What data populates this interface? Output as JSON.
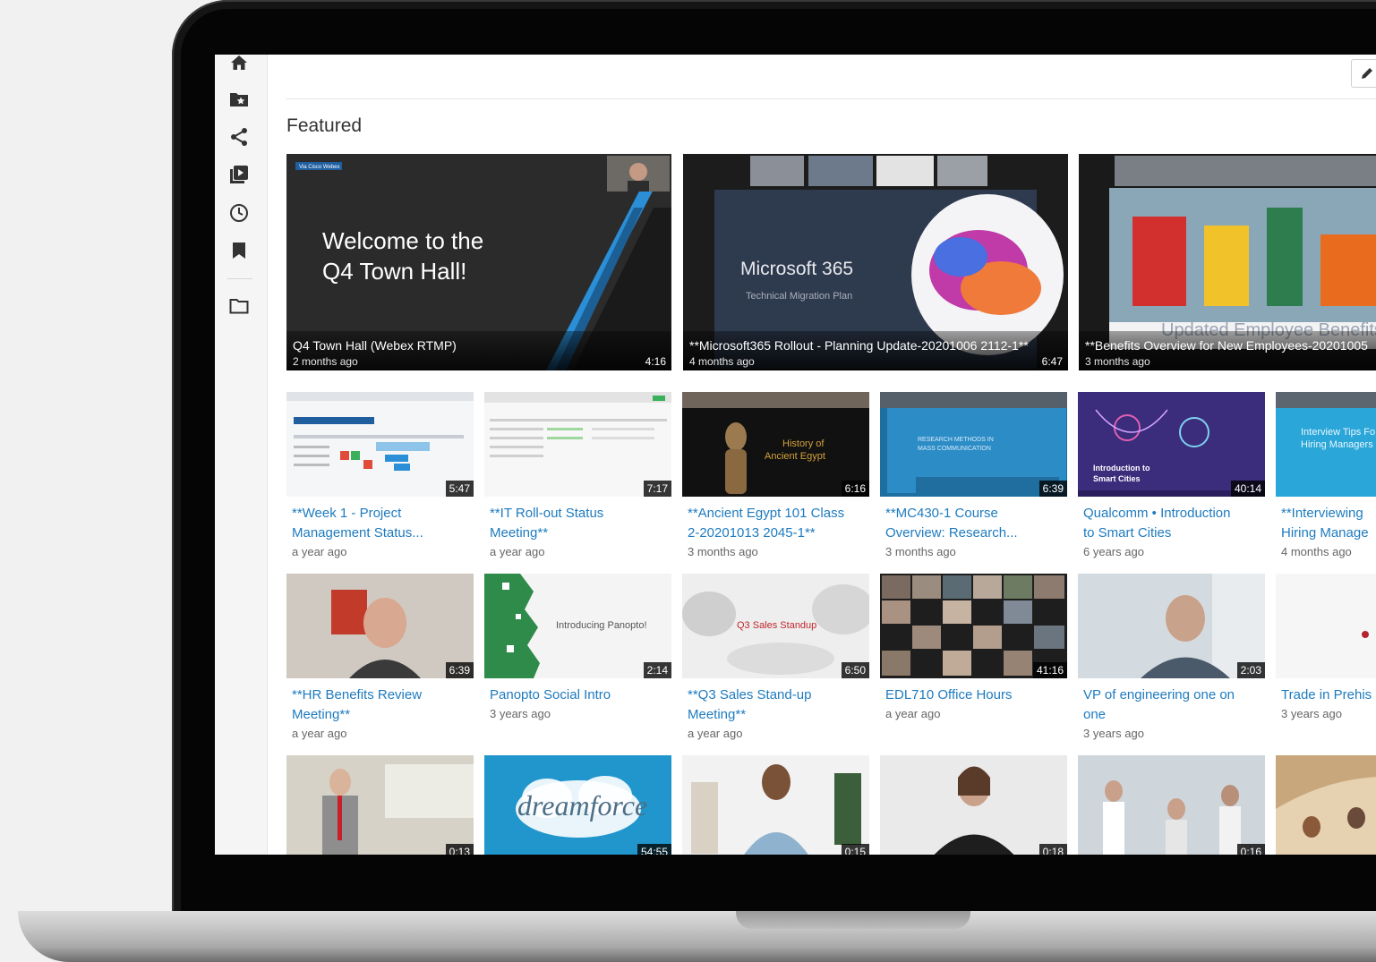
{
  "sidebar": {
    "items": [
      {
        "icon": "home-icon"
      },
      {
        "icon": "starred-folder-icon"
      },
      {
        "icon": "share-icon"
      },
      {
        "icon": "playlist-icon"
      },
      {
        "icon": "clock-icon"
      },
      {
        "icon": "bookmark-icon"
      },
      {
        "icon": "folder-icon"
      }
    ]
  },
  "header": {
    "section_title": "Featured"
  },
  "colors": {
    "link": "#1e7bbf",
    "accent_blue": "#2a8fd6"
  },
  "featured": [
    {
      "title": "Q4 Town Hall (Webex RTMP)",
      "date": "2 months ago",
      "duration": "4:16",
      "slide_line1": "Welcome to the",
      "slide_line2": "Q4 Town Hall!",
      "brand": "Via Cisco Webex"
    },
    {
      "title": "**Microsoft365 Rollout - Planning Update-20201006 2112-1**",
      "date": "4 months ago",
      "duration": "6:47",
      "slide_line1": "Microsoft 365",
      "slide_line2": "Technical Migration Plan"
    },
    {
      "title": "**Benefits Overview for New Employees-20201005",
      "date": "3 months ago",
      "duration": "",
      "slide_line1": "Updated Employee Benefits"
    }
  ],
  "rows": [
    [
      {
        "title1": "**Week 1 - Project",
        "title2": "Management Status...",
        "date": "a year ago",
        "duration": "5:47"
      },
      {
        "title1": "**IT Roll-out Status",
        "title2": "Meeting**",
        "date": "a year ago",
        "duration": "7:17"
      },
      {
        "title1": "**Ancient Egypt 101 Class",
        "title2": "2-20201013 2045-1**",
        "date": "3 months ago",
        "duration": "6:16",
        "thumb_text1": "History of",
        "thumb_text2": "Ancient Egypt"
      },
      {
        "title1": "**MC430-1 Course",
        "title2": "Overview: Research...",
        "date": "3 months ago",
        "duration": "6:39",
        "thumb_text1": "RESEARCH METHODS IN",
        "thumb_text2": "MASS COMMUNICATION"
      },
      {
        "title1": "Qualcomm • Introduction",
        "title2": "to Smart Cities",
        "date": "6 years ago",
        "duration": "40:14",
        "thumb_text1": "Introduction to",
        "thumb_text2": "Smart Cities"
      },
      {
        "title1": "**Interviewing",
        "title2": "Hiring Manage",
        "date": "4 months ago",
        "duration": "",
        "thumb_text1": "Interview Tips Fo",
        "thumb_text2": "Hiring Managers"
      }
    ],
    [
      {
        "title1": "**HR Benefits Review",
        "title2": "Meeting**",
        "date": "a year ago",
        "duration": "6:39"
      },
      {
        "title1": "Panopto Social Intro",
        "title2": "",
        "date": "3 years ago",
        "duration": "2:14",
        "thumb_text1": "Introducing Panopto!"
      },
      {
        "title1": "**Q3 Sales Stand-up",
        "title2": "Meeting**",
        "date": "a year ago",
        "duration": "6:50",
        "thumb_text1": "Q3 Sales Standup"
      },
      {
        "title1": "EDL710 Office Hours",
        "title2": "",
        "date": "a year ago",
        "duration": "41:16"
      },
      {
        "title1": "VP of engineering one on",
        "title2": "one",
        "date": "3 years ago",
        "duration": "2:03"
      },
      {
        "title1": "Trade in Prehis",
        "title2": "",
        "date": "3 years ago",
        "duration": ""
      }
    ],
    [
      {
        "duration": "0:13"
      },
      {
        "duration": "54:55",
        "thumb_text1": "dreamforce"
      },
      {
        "duration": "0:15"
      },
      {
        "duration": "0:18"
      },
      {
        "duration": "0:16"
      },
      {
        "duration": ""
      }
    ]
  ]
}
